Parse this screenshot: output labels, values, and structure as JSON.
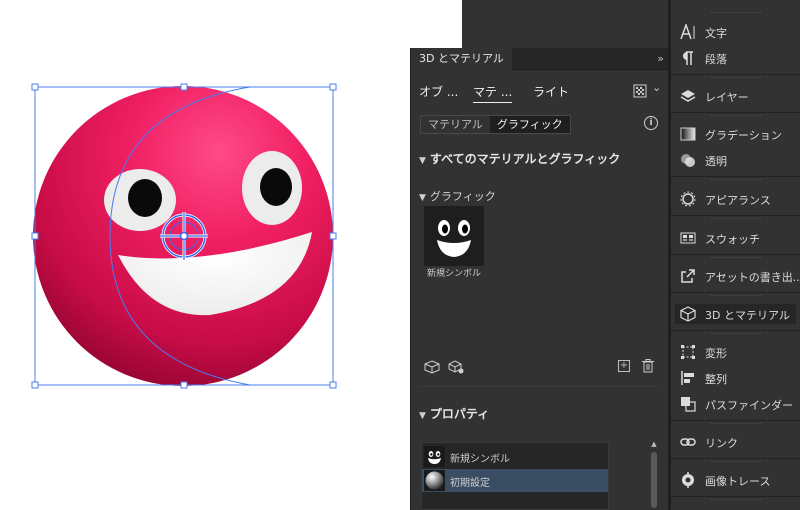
{
  "panel": {
    "title": "3D とマテリアル",
    "collapse_glyph": "»",
    "tabs": [
      "オブ ...",
      "マテ ...",
      "ライト"
    ],
    "segments": [
      "マテリアル",
      "グラフィック"
    ],
    "info_glyph": "i",
    "section_all": "すべてのマテリアルとグラフィック",
    "section_graphic": "グラフィック",
    "symbol_label": "新規シンボル",
    "section_properties": "プロパティ",
    "add_glyph": "+",
    "scroll_up_glyph": "▲",
    "caret_glyph": "⌄",
    "chevron_down": "⌄",
    "props_items": [
      "新規シンボル",
      "初期設定"
    ]
  },
  "dock": {
    "items": [
      "文字",
      "段落",
      "レイヤー",
      "グラデーション",
      "透明",
      "アピアランス",
      "スウォッチ",
      "アセットの書き出...",
      "3D とマテリアル",
      "変形",
      "整列",
      "パスファインダー",
      "リンク",
      "画像トレース"
    ]
  },
  "colors": {
    "panel_bg": "#323232",
    "accent_selection": "#3a4d63",
    "ball": "#e8195a",
    "selection": "#4a7cf0"
  },
  "icons": {
    "render": "render-settings-icon",
    "info": "info-icon"
  }
}
